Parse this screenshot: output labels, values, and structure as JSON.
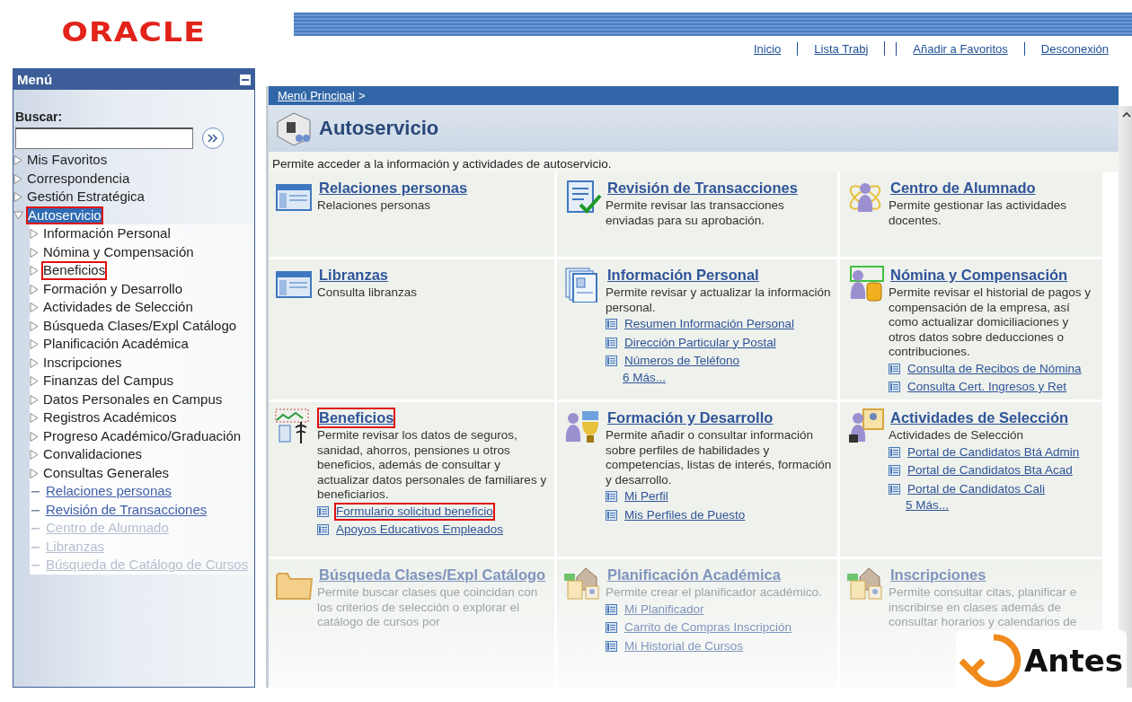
{
  "logo": {
    "text": "ORACLE"
  },
  "nav_links": [
    "Inicio",
    "Lista Trabj",
    "Añadir a Favoritos",
    "Desconexión"
  ],
  "sidebar": {
    "title": "Menú",
    "search_label": "Buscar:",
    "items": [
      {
        "label": "Mis Favoritos",
        "kind": "folder",
        "expanded": false,
        "selected": false,
        "highlighted": false,
        "faded": false
      },
      {
        "label": "Correspondencia",
        "kind": "folder",
        "expanded": false,
        "selected": false,
        "highlighted": false,
        "faded": false
      },
      {
        "label": "Gestión Estratégica",
        "kind": "folder",
        "expanded": false,
        "selected": false,
        "highlighted": false,
        "faded": false
      },
      {
        "label": "Autoservicio",
        "kind": "folder",
        "expanded": true,
        "selected": true,
        "highlighted": true,
        "faded": false,
        "children": [
          {
            "label": "Información Personal",
            "kind": "folder",
            "expanded": false,
            "selected": false,
            "highlighted": false,
            "faded": false
          },
          {
            "label": "Nómina y Compensación",
            "kind": "folder",
            "expanded": false,
            "selected": false,
            "highlighted": false,
            "faded": false
          },
          {
            "label": "Beneficios",
            "kind": "folder",
            "expanded": false,
            "selected": false,
            "highlighted": true,
            "faded": false
          },
          {
            "label": "Formación y Desarrollo",
            "kind": "folder",
            "expanded": false,
            "selected": false,
            "highlighted": false,
            "faded": false
          },
          {
            "label": "Actividades de Selección",
            "kind": "folder",
            "expanded": false,
            "selected": false,
            "highlighted": false,
            "faded": false
          },
          {
            "label": "Búsqueda Clases/Expl Catálogo",
            "kind": "folder",
            "expanded": false,
            "selected": false,
            "highlighted": false,
            "faded": false
          },
          {
            "label": "Planificación Académica",
            "kind": "folder",
            "expanded": false,
            "selected": false,
            "highlighted": false,
            "faded": false
          },
          {
            "label": "Inscripciones",
            "kind": "folder",
            "expanded": false,
            "selected": false,
            "highlighted": false,
            "faded": false
          },
          {
            "label": "Finanzas del Campus",
            "kind": "folder",
            "expanded": false,
            "selected": false,
            "highlighted": false,
            "faded": false
          },
          {
            "label": "Datos Personales en Campus",
            "kind": "folder",
            "expanded": false,
            "selected": false,
            "highlighted": false,
            "faded": false
          },
          {
            "label": "Registros Académicos",
            "kind": "folder",
            "expanded": false,
            "selected": false,
            "highlighted": false,
            "faded": false
          },
          {
            "label": "Progreso Académico/Graduación",
            "kind": "folder",
            "expanded": false,
            "selected": false,
            "highlighted": false,
            "faded": false
          },
          {
            "label": "Convalidaciones",
            "kind": "folder",
            "expanded": false,
            "selected": false,
            "highlighted": false,
            "faded": false
          },
          {
            "label": "Consultas Generales",
            "kind": "folder",
            "expanded": false,
            "selected": false,
            "highlighted": false,
            "faded": false
          },
          {
            "label": "Relaciones personas",
            "kind": "link",
            "selected": false,
            "highlighted": false,
            "faded": false
          },
          {
            "label": "Revisión de Transacciones",
            "kind": "link",
            "selected": false,
            "highlighted": false,
            "faded": false
          },
          {
            "label": "Centro de Alumnado",
            "kind": "link",
            "selected": false,
            "highlighted": false,
            "faded": true
          },
          {
            "label": "Libranzas",
            "kind": "link",
            "selected": false,
            "highlighted": false,
            "faded": true
          },
          {
            "label": "Búsqueda de Catálogo de Cursos",
            "kind": "link",
            "selected": false,
            "highlighted": false,
            "faded": true
          }
        ]
      }
    ]
  },
  "breadcrumb": {
    "link": "Menú Principal",
    "separator": ">"
  },
  "page_title": "Autoservicio",
  "page_description": "Permite acceder a la información y actividades de autoservicio.",
  "cards": [
    {
      "title": "Relaciones personas",
      "description": "Relaciones personas",
      "highlighted": false,
      "faded": false
    },
    {
      "title": "Revisión de Transacciones",
      "description": "Permite revisar las transacciones enviadas para su aprobación.",
      "highlighted": false,
      "faded": false
    },
    {
      "title": "Centro de Alumnado",
      "description": "Permite gestionar las actividades docentes.",
      "highlighted": false,
      "faded": false
    },
    {
      "title": "Libranzas",
      "description": "Consulta libranzas",
      "highlighted": false,
      "faded": false
    },
    {
      "title": "Información Personal",
      "description": "Permite revisar y actualizar la información personal.",
      "highlighted": false,
      "faded": false,
      "links": [
        {
          "label": "Resumen Información Personal",
          "highlighted": false
        },
        {
          "label": "Dirección Particular y Postal",
          "highlighted": false
        },
        {
          "label": "Números de Teléfono",
          "highlighted": false
        }
      ],
      "more": "6 Más..."
    },
    {
      "title": "Nómina y Compensación",
      "description": "Permite revisar el historial de pagos y compensación de la empresa, así como actualizar domiciliaciones y otros datos sobre deducciones o contribuciones.",
      "highlighted": false,
      "faded": false,
      "links": [
        {
          "label": "Consulta de Recibos de Nómina",
          "highlighted": false
        },
        {
          "label": "Consulta Cert. Ingresos y Ret",
          "highlighted": false
        }
      ]
    },
    {
      "title": "Beneficios",
      "description": "Permite revisar los datos de seguros, sanidad, ahorros, pensiones u otros beneficios, además de consultar y actualizar datos personales de familiares y beneficiarios.",
      "highlighted": true,
      "faded": false,
      "links": [
        {
          "label": "Formulario solicitud beneficio",
          "highlighted": true
        },
        {
          "label": "Apoyos Educativos Empleados",
          "highlighted": false
        }
      ]
    },
    {
      "title": "Formación y Desarrollo",
      "description": "Permite añadir o consultar información sobre perfiles de habilidades y competencias, listas de interés, formación y desarrollo.",
      "highlighted": false,
      "faded": false,
      "links": [
        {
          "label": "Mi Perfil",
          "highlighted": false
        },
        {
          "label": "Mis Perfiles de Puesto",
          "highlighted": false
        }
      ]
    },
    {
      "title": "Actividades de Selección",
      "description": "Actividades de Selección",
      "highlighted": false,
      "faded": false,
      "links": [
        {
          "label": "Portal de Candidatos Btá Admin",
          "highlighted": false
        },
        {
          "label": "Portal de Candidatos Bta Acad",
          "highlighted": false
        },
        {
          "label": "Portal de Candidatos Cali",
          "highlighted": false
        }
      ],
      "more": "5 Más..."
    },
    {
      "title": "Búsqueda Clases/Expl Catálogo",
      "description": "Permite buscar clases que coincidan con los criterios de selección o explorar el catálogo de cursos por",
      "highlighted": false,
      "faded": true
    },
    {
      "title": "Planificación Académica",
      "description": "Permite crear el planificador académico.",
      "highlighted": false,
      "faded": true,
      "links": [
        {
          "label": "Mi Planificador",
          "highlighted": false
        },
        {
          "label": "Carrito de Compras Inscripción",
          "highlighted": false
        },
        {
          "label": "Mi Historial de Cursos",
          "highlighted": false
        }
      ]
    },
    {
      "title": "Inscripciones",
      "description": "Permite consultar citas, planificar e inscribirse en clases además de consultar horarios y calendarios de",
      "highlighted": false,
      "faded": true
    }
  ],
  "stamp": {
    "label": "Antes"
  }
}
